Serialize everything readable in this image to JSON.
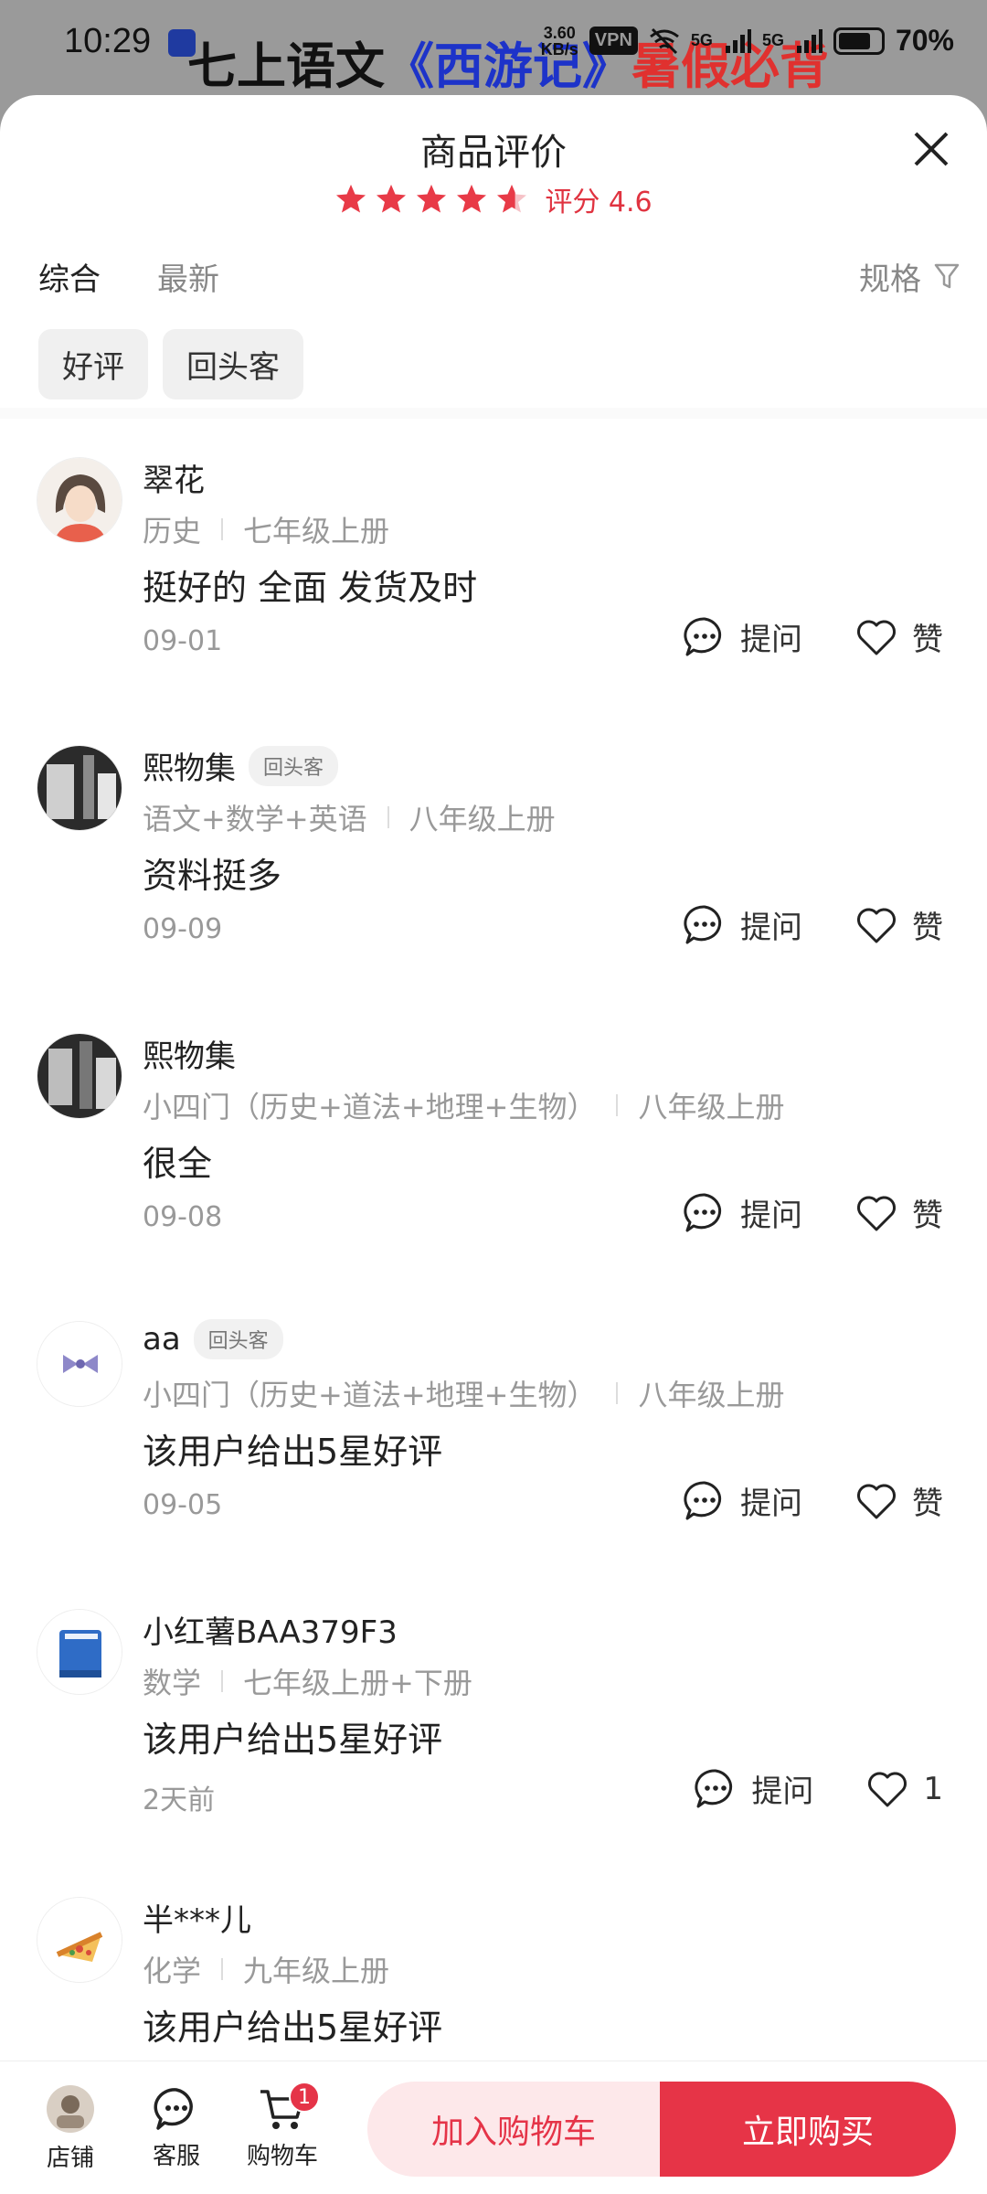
{
  "status_bar": {
    "time": "10:29",
    "net_speed": "3.60",
    "net_unit": "KB/s",
    "vpn": "VPN",
    "signal1": "5G",
    "signal2": "5G",
    "battery": "70%"
  },
  "background": {
    "title_part1": "七上语文",
    "title_part2": "《西游记》",
    "title_part3": "暑假必背"
  },
  "sheet": {
    "title": "商品评价",
    "rating": 4.6,
    "score_text": "评分 4.6"
  },
  "tabs": [
    {
      "label": "综合",
      "active": true
    },
    {
      "label": "最新",
      "active": false
    }
  ],
  "spec_filter": "规格",
  "chips": [
    "好评",
    "回头客"
  ],
  "actions": {
    "ask": "提问",
    "like": "赞"
  },
  "reviews": [
    {
      "name": "翠花",
      "badge": "",
      "spec1": "历史",
      "spec2": "七年级上册",
      "content": "挺好的 全面 发货及时",
      "date": "09-01",
      "like": "赞"
    },
    {
      "name": "熙物集",
      "badge": "回头客",
      "spec1": "语文+数学+英语",
      "spec2": "八年级上册",
      "content": "资料挺多",
      "date": "09-09",
      "like": "赞"
    },
    {
      "name": "熙物集",
      "badge": "",
      "spec1": "小四门（历史+道法+地理+生物）",
      "spec2": "八年级上册",
      "content": "很全",
      "date": "09-08",
      "like": "赞"
    },
    {
      "name": "aa",
      "badge": "回头客",
      "spec1": "小四门（历史+道法+地理+生物）",
      "spec2": "八年级上册",
      "content": "该用户给出5星好评",
      "date": "09-05",
      "like": "赞"
    },
    {
      "name": "小红薯BAA379F3",
      "badge": "",
      "spec1": "数学",
      "spec2": "七年级上册+下册",
      "content": "该用户给出5星好评",
      "date": "2天前",
      "like": "1"
    },
    {
      "name": "半***儿",
      "badge": "",
      "spec1": "化学",
      "spec2": "九年级上册",
      "content": "该用户给出5星好评",
      "date": "",
      "like": ""
    }
  ],
  "bottom_bar": {
    "store": "店铺",
    "service": "客服",
    "cart": "购物车",
    "cart_count": "1",
    "add_to_cart": "加入购物车",
    "buy_now": "立即购买"
  },
  "colors": {
    "accent": "#e63447",
    "star": "#e83a47",
    "muted_text": "#999999"
  }
}
